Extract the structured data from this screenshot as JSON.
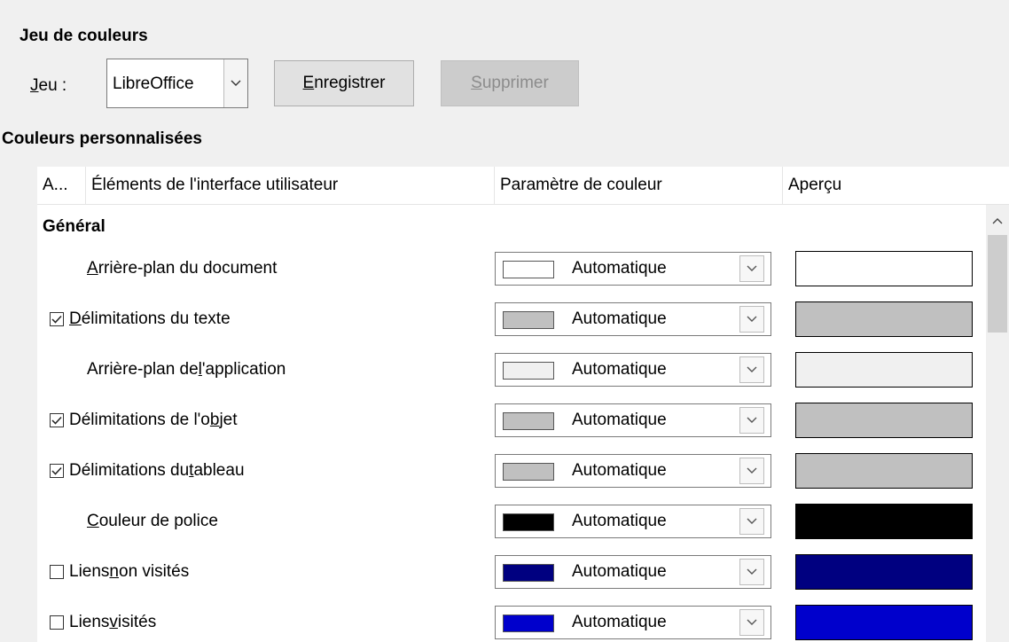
{
  "scheme_section": {
    "title": "Jeu de couleurs",
    "scheme_label_underline": "J",
    "scheme_label_rest": "eu :",
    "scheme_value": "LibreOffice",
    "save_underline": "E",
    "save_rest": "nregistrer",
    "delete_underline": "S",
    "delete_rest": "upprimer"
  },
  "custom_section": {
    "title": "Couleurs personnalisées"
  },
  "columns": {
    "active": "A...",
    "element": "Éléments de l'interface utilisateur",
    "setting": "Paramètre de couleur",
    "preview": "Aperçu"
  },
  "group": {
    "label": "Général"
  },
  "rows": [
    {
      "has_checkbox": false,
      "checked": false,
      "pre": "",
      "ul": "A",
      "post": "rrière-plan du document",
      "combo_value": "Automatique",
      "color": "#ffffff"
    },
    {
      "has_checkbox": true,
      "checked": true,
      "pre": "",
      "ul": "D",
      "post": "élimitations du texte",
      "combo_value": "Automatique",
      "color": "#c0c0c0"
    },
    {
      "has_checkbox": false,
      "checked": false,
      "pre": "Arrière-plan de ",
      "ul": "l",
      "post": "'application",
      "combo_value": "Automatique",
      "color": "#f0f0f0"
    },
    {
      "has_checkbox": true,
      "checked": true,
      "pre": "Délimitations de l'o",
      "ul": "b",
      "post": "jet",
      "combo_value": "Automatique",
      "color": "#c0c0c0"
    },
    {
      "has_checkbox": true,
      "checked": true,
      "pre": "Délimitations du ",
      "ul": "t",
      "post": "ableau",
      "combo_value": "Automatique",
      "color": "#c0c0c0"
    },
    {
      "has_checkbox": false,
      "checked": false,
      "pre": "",
      "ul": "C",
      "post": "ouleur de police",
      "combo_value": "Automatique",
      "color": "#000000"
    },
    {
      "has_checkbox": true,
      "checked": false,
      "pre": "Liens ",
      "ul": "n",
      "post": "on visités",
      "combo_value": "Automatique",
      "color": "#000080"
    },
    {
      "has_checkbox": true,
      "checked": false,
      "pre": "Liens ",
      "ul": "v",
      "post": "isités",
      "combo_value": "Automatique",
      "color": "#0000cc"
    }
  ]
}
